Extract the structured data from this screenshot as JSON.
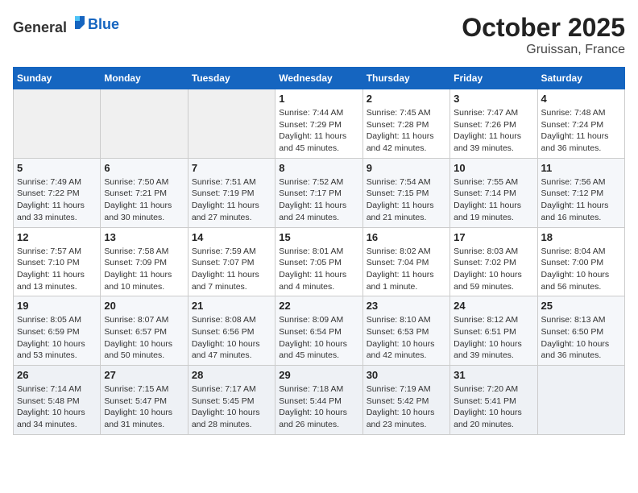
{
  "logo": {
    "general": "General",
    "blue": "Blue"
  },
  "title": "October 2025",
  "subtitle": "Gruissan, France",
  "weekdays": [
    "Sunday",
    "Monday",
    "Tuesday",
    "Wednesday",
    "Thursday",
    "Friday",
    "Saturday"
  ],
  "weeks": [
    [
      {
        "day": "",
        "sunrise": "",
        "sunset": "",
        "daylight": ""
      },
      {
        "day": "",
        "sunrise": "",
        "sunset": "",
        "daylight": ""
      },
      {
        "day": "",
        "sunrise": "",
        "sunset": "",
        "daylight": ""
      },
      {
        "day": "1",
        "sunrise": "Sunrise: 7:44 AM",
        "sunset": "Sunset: 7:29 PM",
        "daylight": "Daylight: 11 hours and 45 minutes."
      },
      {
        "day": "2",
        "sunrise": "Sunrise: 7:45 AM",
        "sunset": "Sunset: 7:28 PM",
        "daylight": "Daylight: 11 hours and 42 minutes."
      },
      {
        "day": "3",
        "sunrise": "Sunrise: 7:47 AM",
        "sunset": "Sunset: 7:26 PM",
        "daylight": "Daylight: 11 hours and 39 minutes."
      },
      {
        "day": "4",
        "sunrise": "Sunrise: 7:48 AM",
        "sunset": "Sunset: 7:24 PM",
        "daylight": "Daylight: 11 hours and 36 minutes."
      }
    ],
    [
      {
        "day": "5",
        "sunrise": "Sunrise: 7:49 AM",
        "sunset": "Sunset: 7:22 PM",
        "daylight": "Daylight: 11 hours and 33 minutes."
      },
      {
        "day": "6",
        "sunrise": "Sunrise: 7:50 AM",
        "sunset": "Sunset: 7:21 PM",
        "daylight": "Daylight: 11 hours and 30 minutes."
      },
      {
        "day": "7",
        "sunrise": "Sunrise: 7:51 AM",
        "sunset": "Sunset: 7:19 PM",
        "daylight": "Daylight: 11 hours and 27 minutes."
      },
      {
        "day": "8",
        "sunrise": "Sunrise: 7:52 AM",
        "sunset": "Sunset: 7:17 PM",
        "daylight": "Daylight: 11 hours and 24 minutes."
      },
      {
        "day": "9",
        "sunrise": "Sunrise: 7:54 AM",
        "sunset": "Sunset: 7:15 PM",
        "daylight": "Daylight: 11 hours and 21 minutes."
      },
      {
        "day": "10",
        "sunrise": "Sunrise: 7:55 AM",
        "sunset": "Sunset: 7:14 PM",
        "daylight": "Daylight: 11 hours and 19 minutes."
      },
      {
        "day": "11",
        "sunrise": "Sunrise: 7:56 AM",
        "sunset": "Sunset: 7:12 PM",
        "daylight": "Daylight: 11 hours and 16 minutes."
      }
    ],
    [
      {
        "day": "12",
        "sunrise": "Sunrise: 7:57 AM",
        "sunset": "Sunset: 7:10 PM",
        "daylight": "Daylight: 11 hours and 13 minutes."
      },
      {
        "day": "13",
        "sunrise": "Sunrise: 7:58 AM",
        "sunset": "Sunset: 7:09 PM",
        "daylight": "Daylight: 11 hours and 10 minutes."
      },
      {
        "day": "14",
        "sunrise": "Sunrise: 7:59 AM",
        "sunset": "Sunset: 7:07 PM",
        "daylight": "Daylight: 11 hours and 7 minutes."
      },
      {
        "day": "15",
        "sunrise": "Sunrise: 8:01 AM",
        "sunset": "Sunset: 7:05 PM",
        "daylight": "Daylight: 11 hours and 4 minutes."
      },
      {
        "day": "16",
        "sunrise": "Sunrise: 8:02 AM",
        "sunset": "Sunset: 7:04 PM",
        "daylight": "Daylight: 11 hours and 1 minute."
      },
      {
        "day": "17",
        "sunrise": "Sunrise: 8:03 AM",
        "sunset": "Sunset: 7:02 PM",
        "daylight": "Daylight: 10 hours and 59 minutes."
      },
      {
        "day": "18",
        "sunrise": "Sunrise: 8:04 AM",
        "sunset": "Sunset: 7:00 PM",
        "daylight": "Daylight: 10 hours and 56 minutes."
      }
    ],
    [
      {
        "day": "19",
        "sunrise": "Sunrise: 8:05 AM",
        "sunset": "Sunset: 6:59 PM",
        "daylight": "Daylight: 10 hours and 53 minutes."
      },
      {
        "day": "20",
        "sunrise": "Sunrise: 8:07 AM",
        "sunset": "Sunset: 6:57 PM",
        "daylight": "Daylight: 10 hours and 50 minutes."
      },
      {
        "day": "21",
        "sunrise": "Sunrise: 8:08 AM",
        "sunset": "Sunset: 6:56 PM",
        "daylight": "Daylight: 10 hours and 47 minutes."
      },
      {
        "day": "22",
        "sunrise": "Sunrise: 8:09 AM",
        "sunset": "Sunset: 6:54 PM",
        "daylight": "Daylight: 10 hours and 45 minutes."
      },
      {
        "day": "23",
        "sunrise": "Sunrise: 8:10 AM",
        "sunset": "Sunset: 6:53 PM",
        "daylight": "Daylight: 10 hours and 42 minutes."
      },
      {
        "day": "24",
        "sunrise": "Sunrise: 8:12 AM",
        "sunset": "Sunset: 6:51 PM",
        "daylight": "Daylight: 10 hours and 39 minutes."
      },
      {
        "day": "25",
        "sunrise": "Sunrise: 8:13 AM",
        "sunset": "Sunset: 6:50 PM",
        "daylight": "Daylight: 10 hours and 36 minutes."
      }
    ],
    [
      {
        "day": "26",
        "sunrise": "Sunrise: 7:14 AM",
        "sunset": "Sunset: 5:48 PM",
        "daylight": "Daylight: 10 hours and 34 minutes."
      },
      {
        "day": "27",
        "sunrise": "Sunrise: 7:15 AM",
        "sunset": "Sunset: 5:47 PM",
        "daylight": "Daylight: 10 hours and 31 minutes."
      },
      {
        "day": "28",
        "sunrise": "Sunrise: 7:17 AM",
        "sunset": "Sunset: 5:45 PM",
        "daylight": "Daylight: 10 hours and 28 minutes."
      },
      {
        "day": "29",
        "sunrise": "Sunrise: 7:18 AM",
        "sunset": "Sunset: 5:44 PM",
        "daylight": "Daylight: 10 hours and 26 minutes."
      },
      {
        "day": "30",
        "sunrise": "Sunrise: 7:19 AM",
        "sunset": "Sunset: 5:42 PM",
        "daylight": "Daylight: 10 hours and 23 minutes."
      },
      {
        "day": "31",
        "sunrise": "Sunrise: 7:20 AM",
        "sunset": "Sunset: 5:41 PM",
        "daylight": "Daylight: 10 hours and 20 minutes."
      },
      {
        "day": "",
        "sunrise": "",
        "sunset": "",
        "daylight": ""
      }
    ]
  ]
}
